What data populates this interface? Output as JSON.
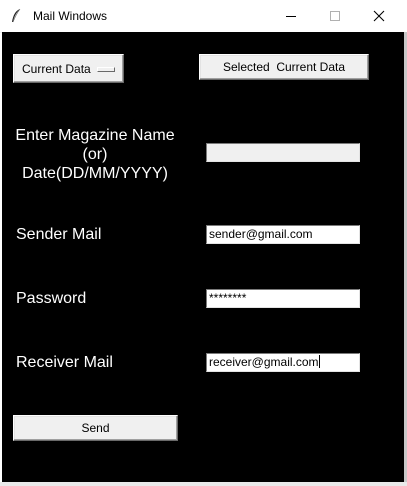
{
  "window": {
    "title": "Mail Windows",
    "icon": "feather-icon",
    "controls": [
      "minimize-icon",
      "maximize-icon",
      "close-icon"
    ]
  },
  "toolbar": {
    "option_menu_value": "Current Data",
    "selected_button_label": "Selected  Current Data"
  },
  "form": {
    "magazine_label_line1": "Enter Magazine Name",
    "magazine_label_line2": "(or)",
    "magazine_label_line3": "Date(DD/MM/YYYY)",
    "magazine_value": "",
    "sender_label": "Sender Mail",
    "sender_value": "sender@gmail.com",
    "password_label": "Password",
    "password_value": "********",
    "receiver_label": "Receiver Mail",
    "receiver_value": "receiver@gmail.com",
    "send_label": "Send"
  },
  "colors": {
    "background": "#000000",
    "label_text": "#ffffff",
    "button_face": "#f0f0f0",
    "disabled_entry": "#f0f0f0"
  }
}
